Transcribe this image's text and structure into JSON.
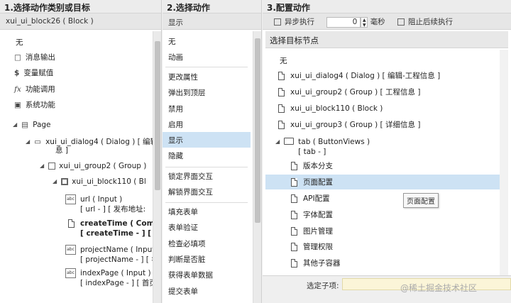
{
  "col1": {
    "title": "1.选择动作类别或目标",
    "subtitle": "xui_ui_block26 ( Block )",
    "categories": [
      {
        "icon": "none",
        "label": "无"
      },
      {
        "icon": "message-icon",
        "label": "消息输出"
      },
      {
        "icon": "dollar-icon",
        "label": "变量赋值"
      },
      {
        "icon": "function-icon",
        "label": "功能调用"
      },
      {
        "icon": "system-icon",
        "label": "系统功能"
      }
    ],
    "tree": {
      "page": "Page",
      "dialog": "xui_ui_dialog4 ( Dialog ) [ 编辑",
      "dialog_cont": "息 ]",
      "group": "xui_ui_group2 ( Group )",
      "block": "xui_ui_block110 ( Bl",
      "url_l1": "url ( Input )",
      "url_l2": "[ url - ] [ 发布地址:",
      "ct_l1": "createTime ( Coml",
      "ct_l2": "[ createTime - ] [ t",
      "pn_l1": "projectName ( Input",
      "pn_l2": "[ projectName - ] [ 名",
      "ip_l1": "indexPage ( Input )",
      "ip_l2": "[ indexPage - ] [ 首页"
    }
  },
  "col2": {
    "title": "2.选择动作",
    "subtitle": "显示",
    "actions": [
      "无",
      "动画",
      "更改属性",
      "弹出到顶层",
      "禁用",
      "启用",
      "显示",
      "隐藏",
      "锁定界面交互",
      "解锁界面交互",
      "填充表单",
      "表单验证",
      "检查必填项",
      "判断是否脏",
      "获得表单数据",
      "提交表单"
    ]
  },
  "col3": {
    "title": "3.配置动作",
    "async_label": "异步执行",
    "delay_value": "0",
    "unit": "毫秒",
    "stop_label": "阻止后续执行",
    "section_title": "选择目标节点",
    "targets": [
      "无",
      "xui_ui_dialog4 ( Dialog ) [ 编辑-工程信息 ]",
      "xui_ui_group2 ( Group ) [ 工程信息 ]",
      "xui_ui_block110 ( Block )",
      "xui_ui_group3 ( Group ) [ 详细信息 ]"
    ],
    "tab_l1": "tab ( ButtonViews )",
    "tab_l2": "[ tab - ]",
    "tab_children": [
      "版本分支",
      "页面配置",
      "API配置",
      "字体配置",
      "图片管理",
      "管理权限",
      "其他子容器"
    ],
    "tooltip": "页面配置",
    "selected_child_label": "选定子项:",
    "selected_child_value": "",
    "watermark": "@稀土掘金技术社区"
  }
}
